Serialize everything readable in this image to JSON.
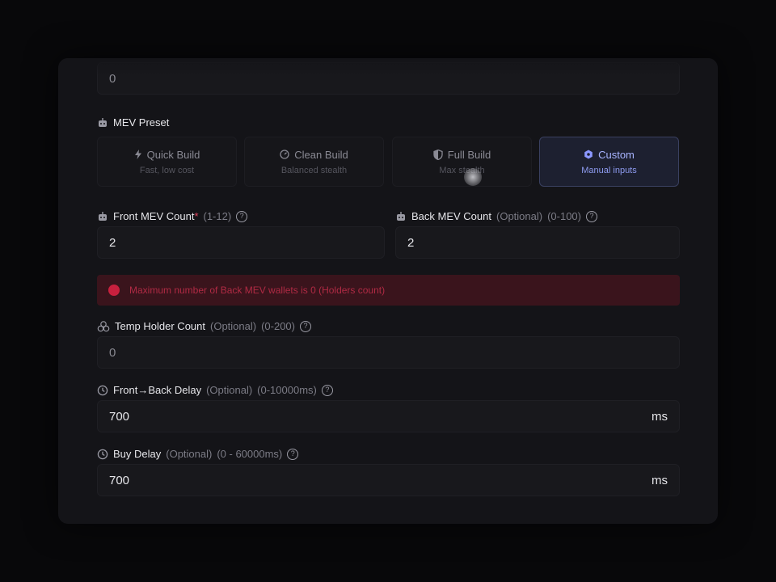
{
  "top_field": {
    "value": "0"
  },
  "mev_preset": {
    "label": "MEV Preset",
    "options": [
      {
        "title": "Quick Build",
        "subtitle": "Fast, low cost",
        "icon": "bolt-icon"
      },
      {
        "title": "Clean Build",
        "subtitle": "Balanced stealth",
        "icon": "gauge-icon"
      },
      {
        "title": "Full Build",
        "subtitle": "Max stealth",
        "icon": "shield-icon"
      },
      {
        "title": "Custom",
        "subtitle": "Manual inputs",
        "icon": "gear-icon",
        "selected": true
      }
    ]
  },
  "front_mev": {
    "label": "Front MEV Count",
    "required": "*",
    "range": "(1-12)",
    "value": "2"
  },
  "back_mev": {
    "label": "Back MEV Count",
    "optional": "(Optional)",
    "range": "(0-100)",
    "value": "2"
  },
  "error": {
    "message": "Maximum number of Back MEV wallets is 0 (Holders count)"
  },
  "temp_holder": {
    "label": "Temp Holder Count",
    "optional": "(Optional)",
    "range": "(0-200)",
    "value": "0"
  },
  "front_back_delay": {
    "label": "Front→Back Delay",
    "optional": "(Optional)",
    "range": "(0-10000ms)",
    "value": "700",
    "unit": "ms"
  },
  "buy_delay": {
    "label": "Buy Delay",
    "optional": "(Optional)",
    "range": "(0 - 60000ms)",
    "value": "700",
    "unit": "ms"
  },
  "colors": {
    "accent": "#a8b4ff",
    "error": "#c8203e",
    "background": "#141418"
  }
}
